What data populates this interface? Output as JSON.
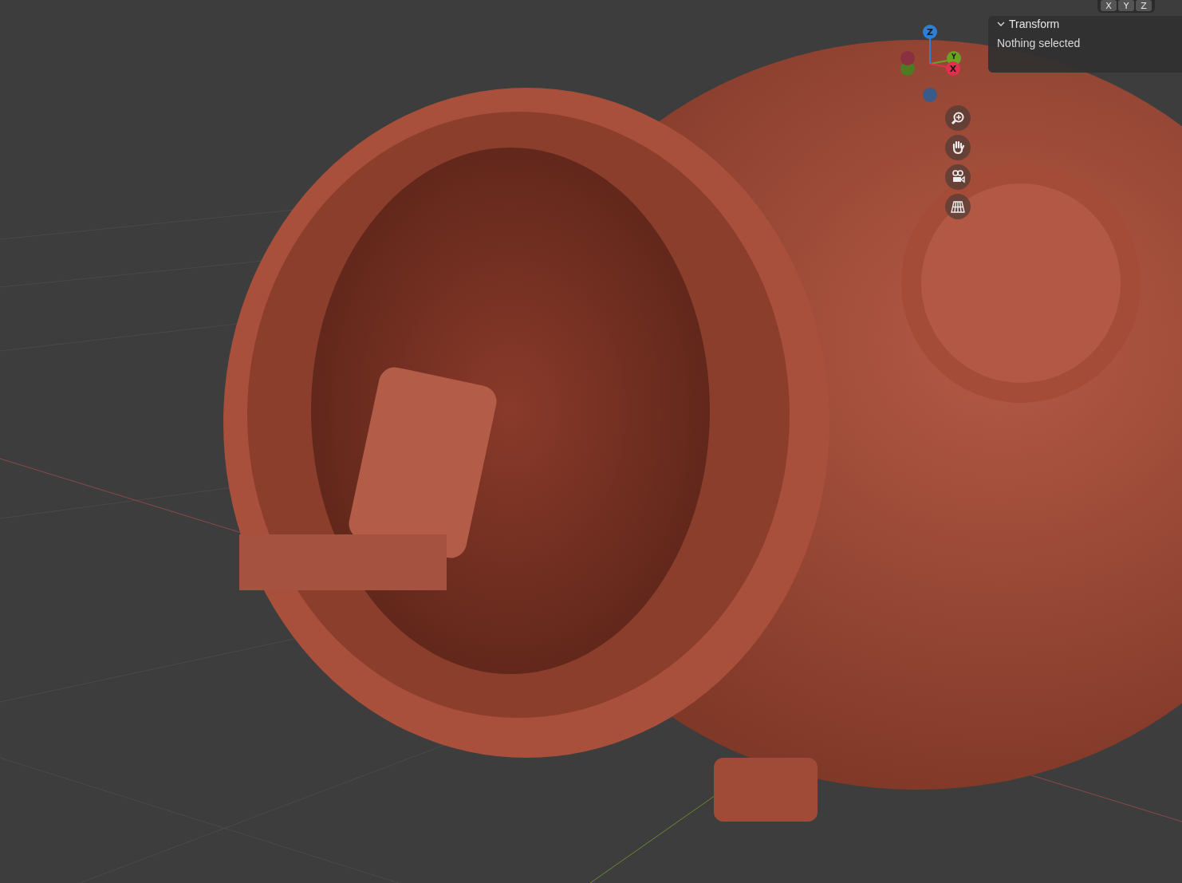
{
  "header_axes": [
    {
      "label": "X"
    },
    {
      "label": "Y"
    },
    {
      "label": "Z"
    }
  ],
  "gizmo": {
    "axes": [
      {
        "kind": "z",
        "label": "Z"
      },
      {
        "kind": "y",
        "label": "Y"
      },
      {
        "kind": "x",
        "label": "X"
      }
    ]
  },
  "nav_buttons": [
    {
      "kind": "zoom"
    },
    {
      "kind": "pan"
    },
    {
      "kind": "camera"
    },
    {
      "kind": "ortho"
    }
  ],
  "sidebar_panel": {
    "title": "Transform",
    "expanded": true,
    "message": "Nothing selected"
  }
}
